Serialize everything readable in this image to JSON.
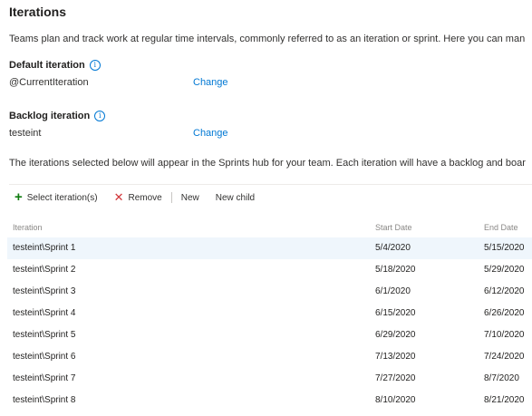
{
  "page": {
    "title": "Iterations",
    "description": "Teams plan and track work at regular time intervals, commonly referred to as an iteration or sprint. Here you can man"
  },
  "default_iteration": {
    "label": "Default iteration",
    "value": "@CurrentIteration",
    "change_label": "Change",
    "info_icon": "i"
  },
  "backlog_iteration": {
    "label": "Backlog iteration",
    "value": "testeint",
    "change_label": "Change",
    "info_icon": "i"
  },
  "sprints_note": "The iterations selected below will appear in the Sprints hub for your team. Each iteration will have a backlog and boar",
  "toolbar": {
    "select_label": "Select iteration(s)",
    "select_icon": "+",
    "remove_label": "Remove",
    "remove_icon": "✕",
    "new_label": "New",
    "new_child_label": "New child"
  },
  "grid": {
    "headers": [
      "Iteration",
      "Start Date",
      "End Date"
    ],
    "rows": [
      [
        "testeint\\Sprint 1",
        "5/4/2020",
        "5/15/2020"
      ],
      [
        "testeint\\Sprint 2",
        "5/18/2020",
        "5/29/2020"
      ],
      [
        "testeint\\Sprint 3",
        "6/1/2020",
        "6/12/2020"
      ],
      [
        "testeint\\Sprint 4",
        "6/15/2020",
        "6/26/2020"
      ],
      [
        "testeint\\Sprint 5",
        "6/29/2020",
        "7/10/2020"
      ],
      [
        "testeint\\Sprint 6",
        "7/13/2020",
        "7/24/2020"
      ],
      [
        "testeint\\Sprint 7",
        "7/27/2020",
        "8/7/2020"
      ],
      [
        "testeint\\Sprint 8",
        "8/10/2020",
        "8/21/2020"
      ]
    ]
  },
  "colors": {
    "link": "#0078d4",
    "add": "#107c10",
    "remove": "#d13438",
    "selected_row": "#eff6fc"
  }
}
